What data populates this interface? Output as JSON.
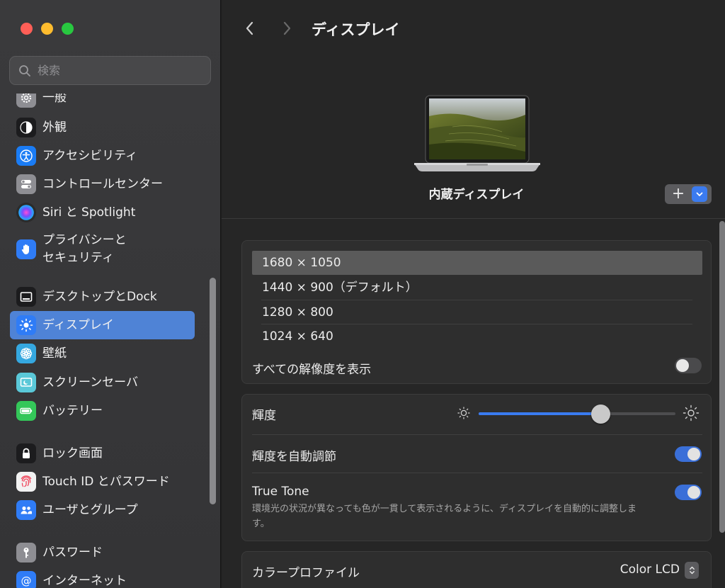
{
  "window": {
    "traffic_lights": [
      "close",
      "minimize",
      "zoom"
    ]
  },
  "sidebar": {
    "search": {
      "placeholder": "検索",
      "value": ""
    },
    "items": [
      {
        "label": "一般",
        "icon": "gear-icon",
        "color": "#8e8e93"
      },
      {
        "label": "外観",
        "icon": "appearance-icon",
        "color": "#1c1c1e"
      },
      {
        "label": "アクセシビリティ",
        "icon": "accessibility-icon",
        "color": "#1a7cf5"
      },
      {
        "label": "コントロールセンター",
        "icon": "control-center-icon",
        "color": "#8e8e93"
      },
      {
        "label": "Siri と Spotlight",
        "icon": "siri-icon",
        "color": "#2b2b2b"
      },
      {
        "label_line1": "プライバシーと",
        "label_line2": "セキュリティ",
        "icon": "hand-icon",
        "color": "#2f7cf6"
      },
      {
        "label": "デスクトップとDock",
        "icon": "dock-icon",
        "color": "#1c1c1e"
      },
      {
        "label": "ディスプレイ",
        "icon": "brightness-icon",
        "color": "#2f7cf6",
        "selected": true
      },
      {
        "label": "壁紙",
        "icon": "wallpaper-icon",
        "color": "#35a8e0"
      },
      {
        "label": "スクリーンセーバ",
        "icon": "screensaver-icon",
        "color": "#5ac8d8"
      },
      {
        "label": "バッテリー",
        "icon": "battery-icon",
        "color": "#34c759"
      },
      {
        "label": "ロック画面",
        "icon": "lock-icon",
        "color": "#1c1c1e"
      },
      {
        "label": "Touch ID とパスワード",
        "icon": "fingerprint-icon",
        "color": "#f2f2f2"
      },
      {
        "label": "ユーザとグループ",
        "icon": "users-icon",
        "color": "#2f7cf6"
      },
      {
        "label": "パスワード",
        "icon": "key-icon",
        "color": "#8e8e93"
      },
      {
        "label": "インターネット",
        "icon": "at-icon",
        "color": "#2f7cf6"
      }
    ]
  },
  "toolbar": {
    "title": "ディスプレイ"
  },
  "display": {
    "name": "内蔵ディスプレイ",
    "add_label": "+"
  },
  "resolutions": {
    "options": [
      "1680 × 1050",
      "1440 × 900（デフォルト）",
      "1280 × 800",
      "1024 × 640"
    ],
    "selected_index": 0,
    "show_all_label": "すべての解像度を表示",
    "show_all_on": false
  },
  "brightness": {
    "label": "輝度",
    "value": 0.62,
    "auto_label": "輝度を自動調節",
    "auto_on": true,
    "truetone_label": "True Tone",
    "truetone_on": true,
    "truetone_desc": "環境光の状況が異なっても色が一貫して表示されるように、ディスプレイを自動的に調整します。"
  },
  "color_profile": {
    "label": "カラープロファイル",
    "value": "Color LCD"
  }
}
